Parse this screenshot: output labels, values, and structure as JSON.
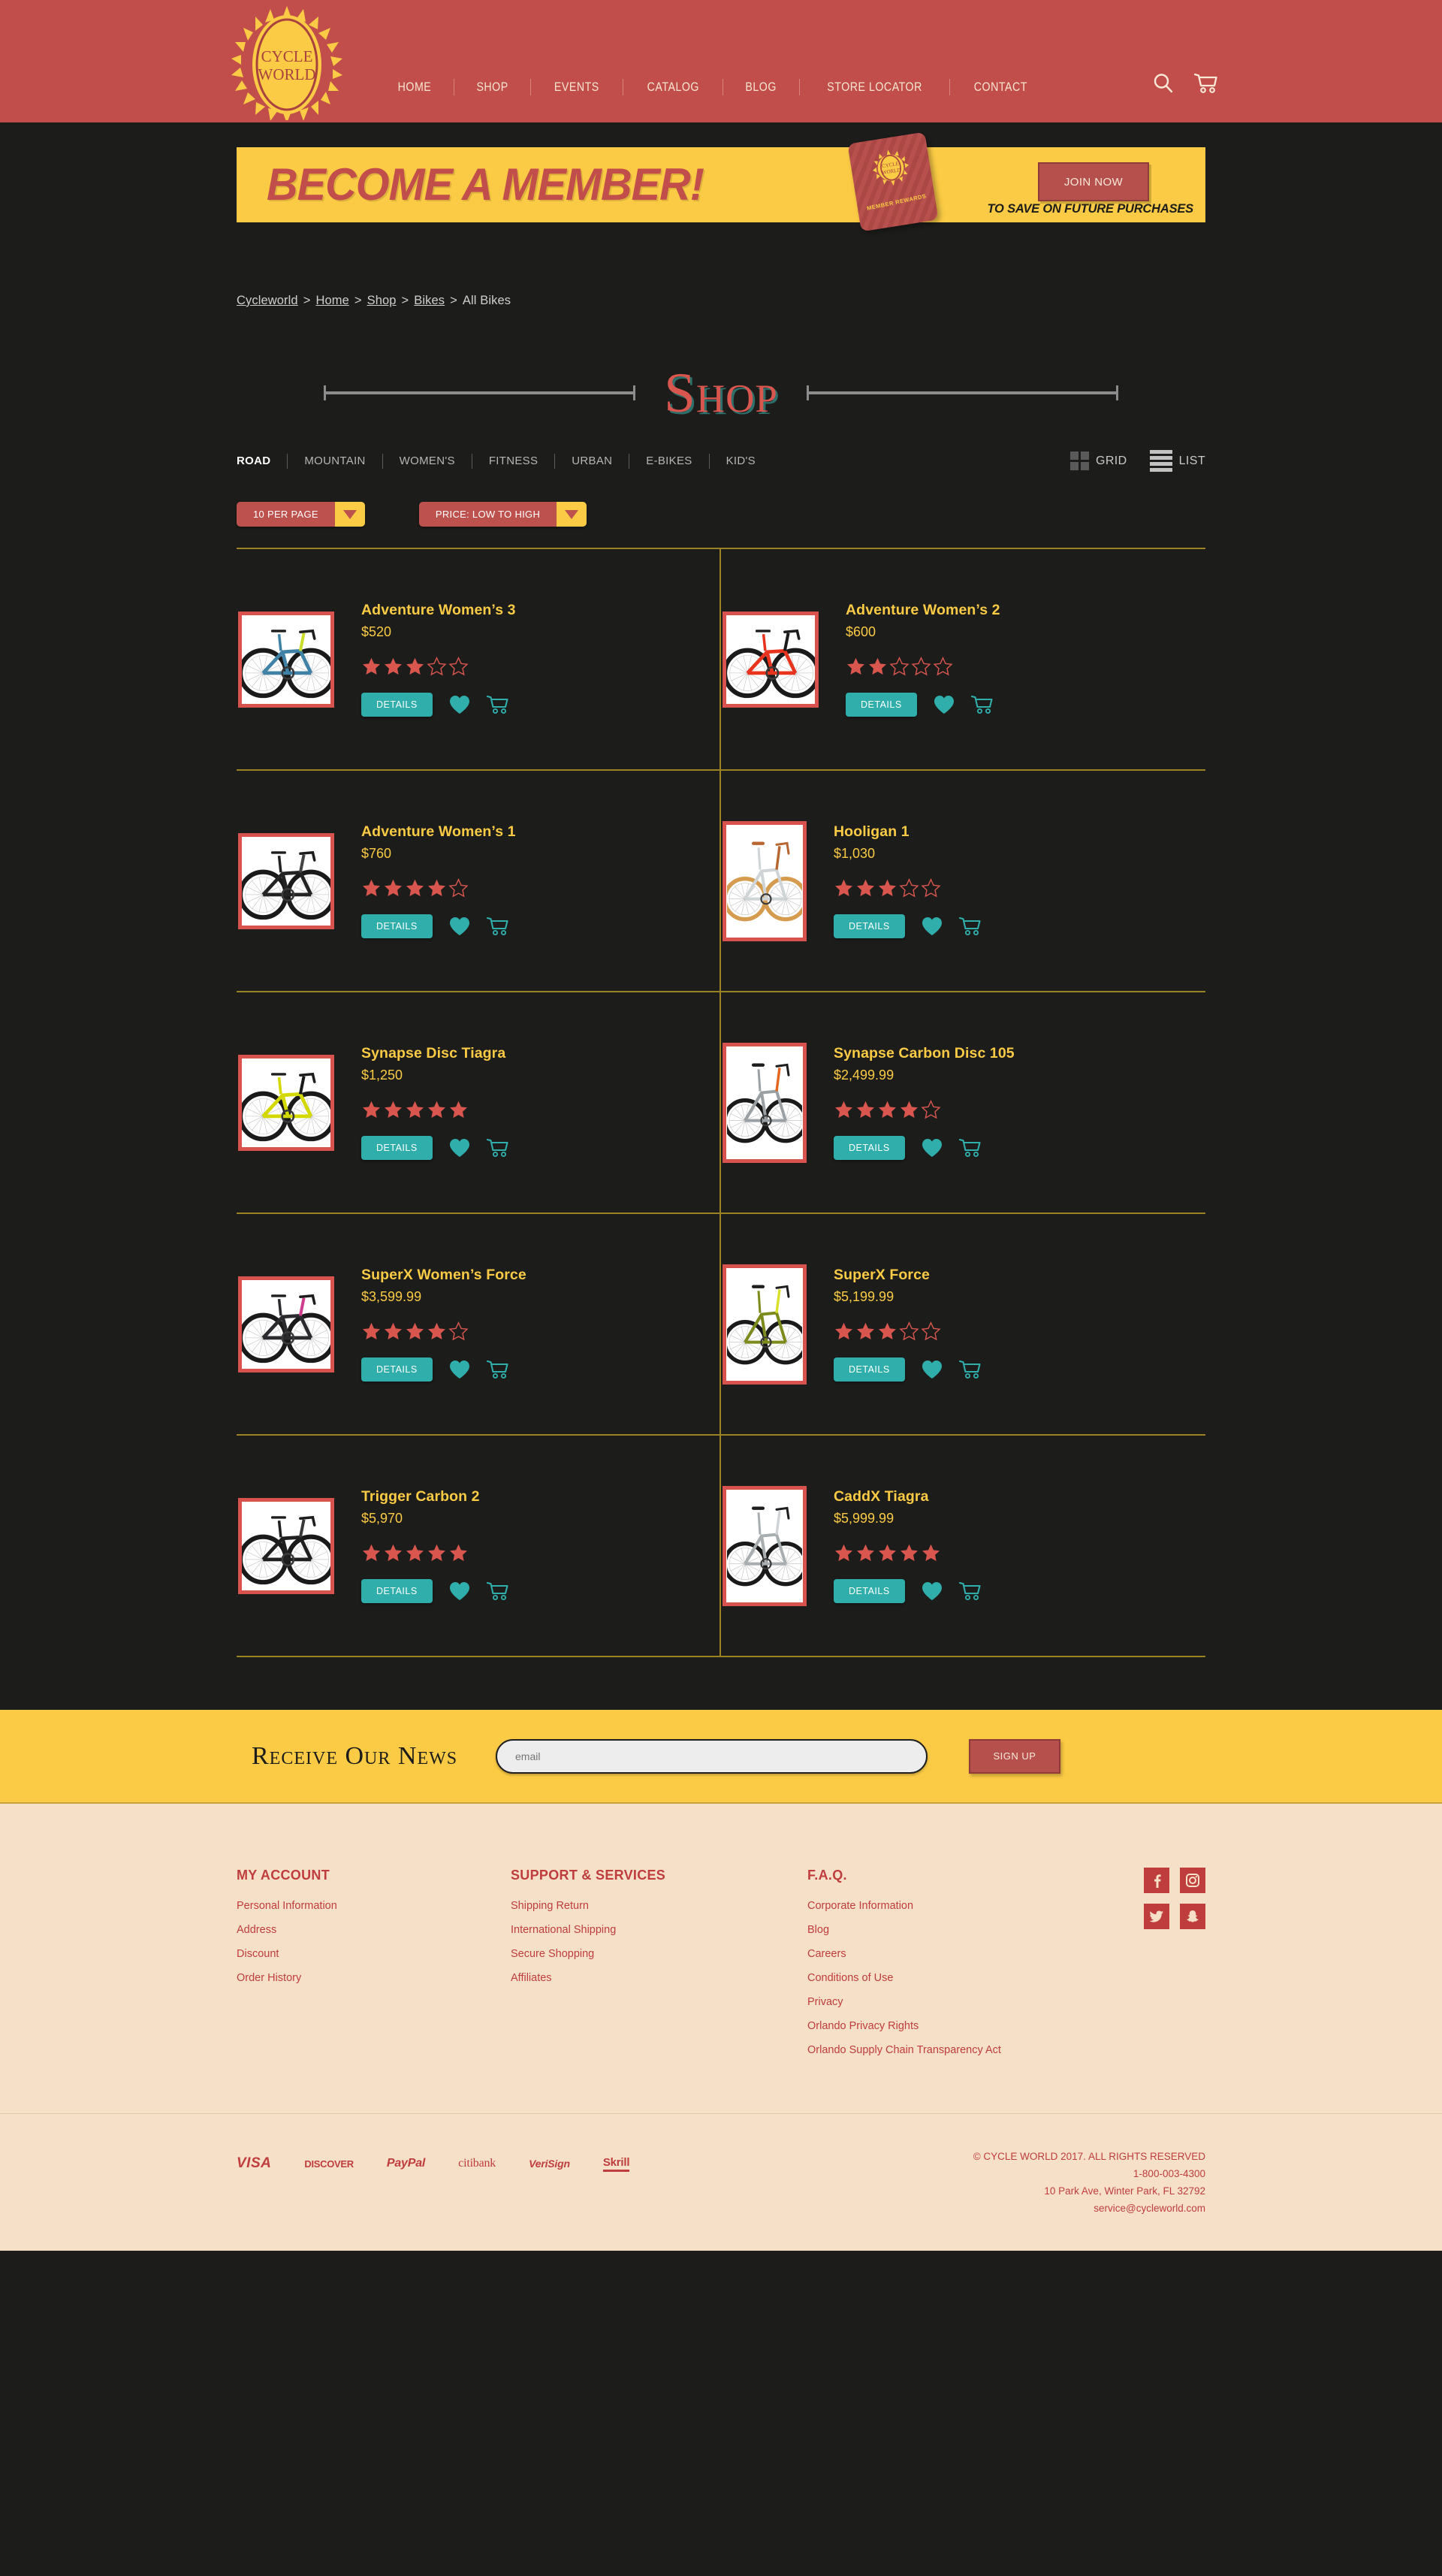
{
  "header": {
    "logo": {
      "line1": "CYCLE",
      "line2": "WORLD"
    },
    "nav": [
      {
        "label": "HOME"
      },
      {
        "label": "SHOP"
      },
      {
        "label": "EVENTS"
      },
      {
        "label": "CATALOG"
      },
      {
        "label": "BLOG"
      },
      {
        "label": "STORE LOCATOR"
      },
      {
        "label": "CONTACT"
      }
    ],
    "icons": [
      "search-icon",
      "cart-icon"
    ],
    "colors": {
      "bar": "#c14e4b",
      "logo": "#fbcb45"
    }
  },
  "banner": {
    "title": "BECOME A MEMBER!",
    "card_text": "MEMBER REWARDS",
    "card_logo_line1": "CYCLE",
    "card_logo_line2": "WORLD",
    "button": "JOIN NOW",
    "subtitle": "TO SAVE ON FUTURE PURCHASES",
    "colors": {
      "bg": "#fbcb45",
      "text": "#c14e4b"
    }
  },
  "breadcrumb": {
    "items": [
      "Cycleworld",
      "Home",
      "Shop",
      "Bikes"
    ],
    "current": "All  Bikes",
    "separator": ">"
  },
  "page_title": "Shop",
  "categories": {
    "items": [
      {
        "label": "ROAD",
        "active": true
      },
      {
        "label": "MOUNTAIN",
        "active": false
      },
      {
        "label": "WOMEN'S",
        "active": false
      },
      {
        "label": "FITNESS",
        "active": false
      },
      {
        "label": "URBAN",
        "active": false
      },
      {
        "label": "E-BIKES",
        "active": false
      },
      {
        "label": "KID'S",
        "active": false
      }
    ]
  },
  "view_toggle": {
    "grid_label": "GRID",
    "list_label": "LIST"
  },
  "filters": {
    "per_page": "10 PER PAGE",
    "sort": "PRICE: LOW TO HIGH"
  },
  "product_actions": {
    "details_label": "DETAILS",
    "wishlist_icon": "heart-icon",
    "cart_icon": "cart-icon"
  },
  "products": [
    {
      "name": "Adventure Women’s 3",
      "price": "$520",
      "rating": 3,
      "max_rating": 5,
      "image": "bike-blue-gravel",
      "tall": false
    },
    {
      "name": "Adventure Women’s 2",
      "price": "$600",
      "rating": 2,
      "max_rating": 5,
      "image": "bike-red-road",
      "tall": false
    },
    {
      "name": "Adventure Women’s 1",
      "price": "$760",
      "rating": 4,
      "max_rating": 5,
      "image": "bike-black-road",
      "tall": false
    },
    {
      "name": "Hooligan 1",
      "price": "$1,030",
      "rating": 3,
      "max_rating": 5,
      "image": "bike-white-classic",
      "tall": true
    },
    {
      "name": "Synapse Disc Tiagra",
      "price": "$1,250",
      "rating": 5,
      "max_rating": 5,
      "image": "bike-yellow-road",
      "tall": false
    },
    {
      "name": "Synapse Carbon Disc 105",
      "price": "$2,499.99",
      "rating": 4,
      "max_rating": 5,
      "image": "bike-silver-road",
      "tall": true
    },
    {
      "name": "SuperX Women’s Force",
      "price": "$3,599.99",
      "rating": 4,
      "max_rating": 5,
      "image": "bike-dark-cross",
      "tall": false
    },
    {
      "name": "SuperX Force",
      "price": "$5,199.99",
      "rating": 3,
      "max_rating": 5,
      "image": "bike-olive-cross",
      "tall": true
    },
    {
      "name": "Trigger Carbon 2",
      "price": "$5,970",
      "rating": 5,
      "max_rating": 5,
      "image": "bike-black-mtb",
      "tall": false
    },
    {
      "name": "CaddX Tiagra",
      "price": "$5,999.99",
      "rating": 5,
      "max_rating": 5,
      "image": "bike-silver-comfort",
      "tall": true
    }
  ],
  "newsletter": {
    "title": "Receive Our News",
    "placeholder": "email",
    "value": "",
    "button": "SIGN UP",
    "colors": {
      "bg": "#fbcb45"
    }
  },
  "footer": {
    "columns": [
      {
        "heading": "MY ACCOUNT",
        "links": [
          "Personal Information",
          "Address",
          "Discount",
          "Order History"
        ]
      },
      {
        "heading": "SUPPORT & SERVICES",
        "links": [
          "Shipping Return",
          "International Shipping",
          "Secure Shopping",
          "Affiliates"
        ]
      },
      {
        "heading": "F.A.Q.",
        "links": [
          "Corporate Information",
          "Blog",
          "Careers",
          "Conditions of Use",
          "Privacy",
          "Orlando Privacy Rights",
          "Orlando Supply Chain Transparency Act"
        ]
      }
    ],
    "socials": [
      "facebook-icon",
      "instagram-icon",
      "twitter-icon",
      "snapchat-icon"
    ],
    "payments": [
      "VISA",
      "DISCOVER",
      "PayPal",
      "citibank",
      "VeriSign",
      "Skrill"
    ],
    "copyright": "© CYCLE WORLD 2017.  ALL RIGHTS RESERVED",
    "phone": "1-800-003-4300",
    "address": "10 Park Ave, Winter Park, FL 32792",
    "email": "service@cycleworld.com",
    "colors": {
      "bg": "#f6e0c8",
      "text": "#bf3d3d"
    }
  }
}
